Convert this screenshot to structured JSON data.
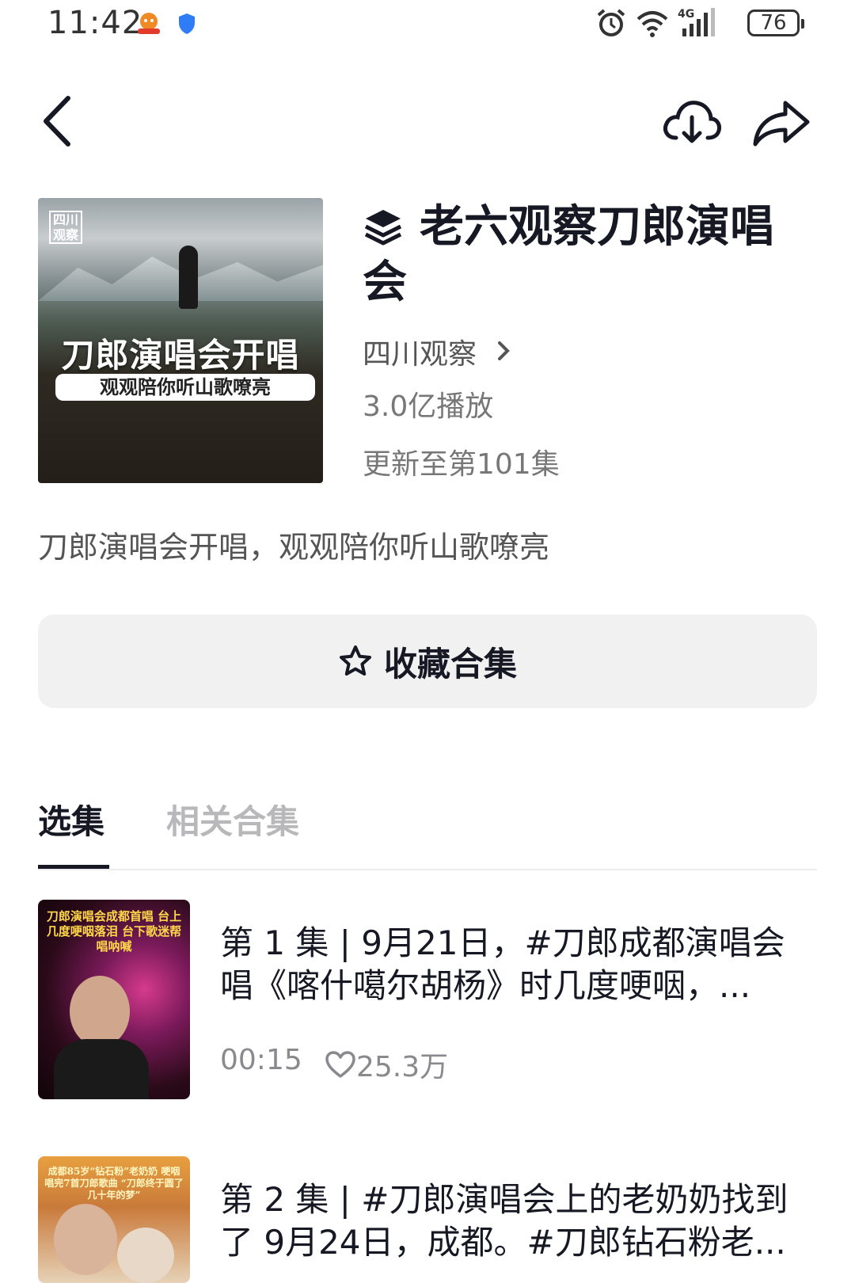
{
  "status_bar": {
    "time": "11:42",
    "battery": "76",
    "network": "4G"
  },
  "header": {
    "back_icon": "back-arrow-icon",
    "download_icon": "cloud-download-icon",
    "share_icon": "share-icon"
  },
  "collection": {
    "cover": {
      "badge": "四川观察",
      "title": "刀郎演唱会开唱",
      "subtitle": "观观陪你听山歌嘹亮"
    },
    "title": "老六观察刀郎演唱会",
    "author": "四川观察",
    "plays": "3.0亿播放",
    "updated": "更新至第101集",
    "description": "刀郎演唱会开唱，观观陪你听山歌嘹亮",
    "favorite_label": "收藏合集"
  },
  "tabs": [
    {
      "label": "选集",
      "active": true
    },
    {
      "label": "相关合集",
      "active": false
    }
  ],
  "episodes": [
    {
      "title": "第 1 集 | 9月21日，#刀郎成都演唱会 唱《喀什噶尔胡杨》时几度哽咽，...",
      "thumb_text": "刀郎演唱会成都首唱 台上几度哽咽落泪 台下歌迷帮唱呐喊",
      "duration": "00:15",
      "likes": "25.3万"
    },
    {
      "title": "第 2 集 | #刀郎演唱会上的老奶奶找到了 9月24日，成都。#刀郎钻石粉老...",
      "thumb_text": "成都85岁“钻石粉”老奶奶 哽咽唱完7首刀郎歌曲 “刀郎终于圆了几十年的梦”"
    }
  ],
  "colors": {
    "text_primary": "#161823",
    "text_secondary": "#8a8a8e",
    "button_bg": "#f1f1f2",
    "tab_inactive": "#b8b8ba"
  }
}
